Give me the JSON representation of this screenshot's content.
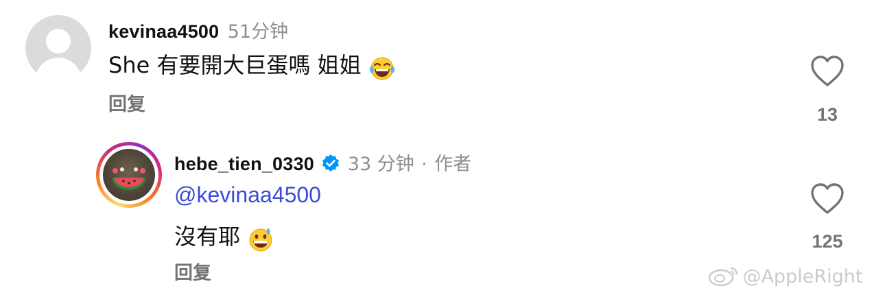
{
  "comments": [
    {
      "username": "kevinaa4500",
      "time": "51分钟",
      "text": "She 有要開大巨蛋嗎 姐姐",
      "emoji_icon": "tears-of-joy-emoji",
      "reply_label": "回复",
      "like_count": "13"
    },
    {
      "username": "hebe_tien_0330",
      "verified": true,
      "time": "33 分钟",
      "separator": "·",
      "author_tag": "作者",
      "mention": "@kevinaa4500",
      "text": "沒有耶",
      "emoji_icon": "grinning-sweat-emoji",
      "reply_label": "回复",
      "like_count": "125"
    }
  ],
  "watermark": "@AppleRight",
  "colors": {
    "mention": "#3a4bd9",
    "verified": "#0095f6",
    "meta_gray": "#8e8e8e"
  }
}
